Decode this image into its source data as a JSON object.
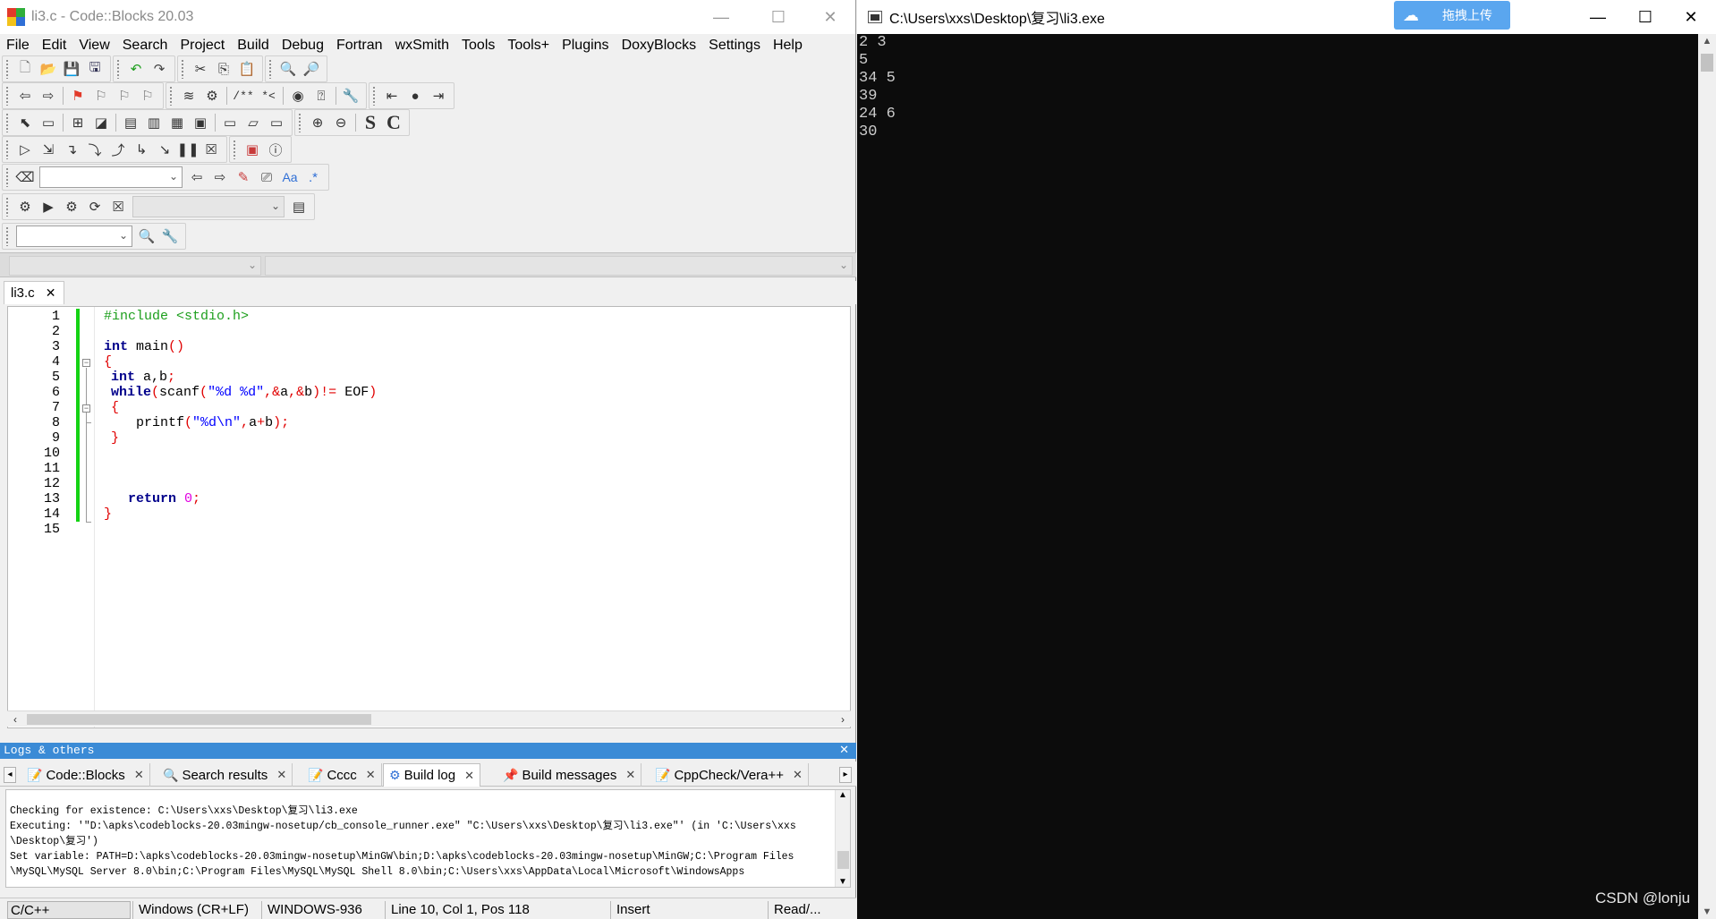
{
  "cb_window": {
    "title": "li3.c - Code::Blocks 20.03",
    "controls": {
      "minimize": "—",
      "maximize": "☐",
      "close": "✕"
    }
  },
  "menu": [
    "File",
    "Edit",
    "View",
    "Search",
    "Project",
    "Build",
    "Debug",
    "Fortran",
    "wxSmith",
    "Tools",
    "Tools+",
    "Plugins",
    "DoxyBlocks",
    "Settings",
    "Help"
  ],
  "toolbar_text": {
    "doxy_comment": "/**",
    "doxy_line": "*<",
    "bold_s": "S",
    "bold_c": "C",
    "aa": "Aa",
    "regex": ".*"
  },
  "editor": {
    "file_tab": "li3.c",
    "line_numbers": [
      "1",
      "2",
      "3",
      "4",
      "5",
      "6",
      "7",
      "8",
      "9",
      "10",
      "11",
      "12",
      "13",
      "14",
      "15"
    ],
    "code": {
      "l1": "#include <stdio.h>",
      "l3_kw": "int",
      "l3_rest": " main",
      "l3_paren": "()",
      "l4_brace": "{",
      "l5_kw": "int",
      "l5_rest": " a,b",
      "l5_semi": ";",
      "l6_kw": "while",
      "l6_p1": "(",
      "l6_fn": "scanf",
      "l6_p2": "(",
      "l6_str": "\"%d %d\"",
      "l6_c": ",",
      "l6_amp1": "&",
      "l6_a": "a",
      "l6_c2": ",",
      "l6_amp2": "&",
      "l6_b": "b",
      "l6_p3": ")!=",
      "l6_eof": " EOF",
      "l6_p4": ")",
      "l7_brace": "{",
      "l8_fn": "printf",
      "l8_p1": "(",
      "l8_str": "\"%d\\n\"",
      "l8_c": ",",
      "l8_a": "a",
      "l8_plus": "+",
      "l8_b": "b",
      "l8_p2": ");",
      "l9_brace": "}",
      "l13_kw": "return",
      "l13_num": " 0",
      "l13_semi": ";",
      "l14_brace": "}"
    }
  },
  "logs": {
    "panel_title": "Logs & others",
    "tabs": [
      {
        "label": "Code::Blocks"
      },
      {
        "label": "Search results"
      },
      {
        "label": "Cccc"
      },
      {
        "label": "Build log"
      },
      {
        "label": "Build messages"
      },
      {
        "label": "CppCheck/Vera++"
      }
    ],
    "lines": [
      "Checking for existence: C:\\Users\\xxs\\Desktop\\复习\\li3.exe",
      "Executing: '\"D:\\apks\\codeblocks-20.03mingw-nosetup/cb_console_runner.exe\" \"C:\\Users\\xxs\\Desktop\\复习\\li3.exe\"' (in 'C:\\Users\\xxs",
      "\\Desktop\\复习')",
      "Set variable: PATH=D:\\apks\\codeblocks-20.03mingw-nosetup\\MinGW\\bin;D:\\apks\\codeblocks-20.03mingw-nosetup\\MinGW;C:\\Program Files",
      "\\MySQL\\MySQL Server 8.0\\bin;C:\\Program Files\\MySQL\\MySQL Shell 8.0\\bin;C:\\Users\\xxs\\AppData\\Local\\Microsoft\\WindowsApps"
    ]
  },
  "status": {
    "language": "C/C++",
    "line_endings": "Windows (CR+LF)",
    "encoding": "WINDOWS-936",
    "position": "Line 10, Col 1, Pos 118",
    "mode": "Insert",
    "access": "Read/..."
  },
  "console": {
    "title": "C:\\Users\\xxs\\Desktop\\复习\\li3.exe",
    "upload_button": "拖拽上传",
    "controls": {
      "minimize": "—",
      "maximize": "☐",
      "close": "✕"
    },
    "lines": [
      "2 3",
      "5",
      "34 5",
      "39",
      "24 6",
      "30"
    ]
  },
  "watermark": "CSDN @lonju",
  "colors": {
    "accent_blue": "#3b8bd6",
    "change_bar": "#14d314",
    "console_bg": "#0c0c0c",
    "upload_btn": "#5aa6ef"
  }
}
